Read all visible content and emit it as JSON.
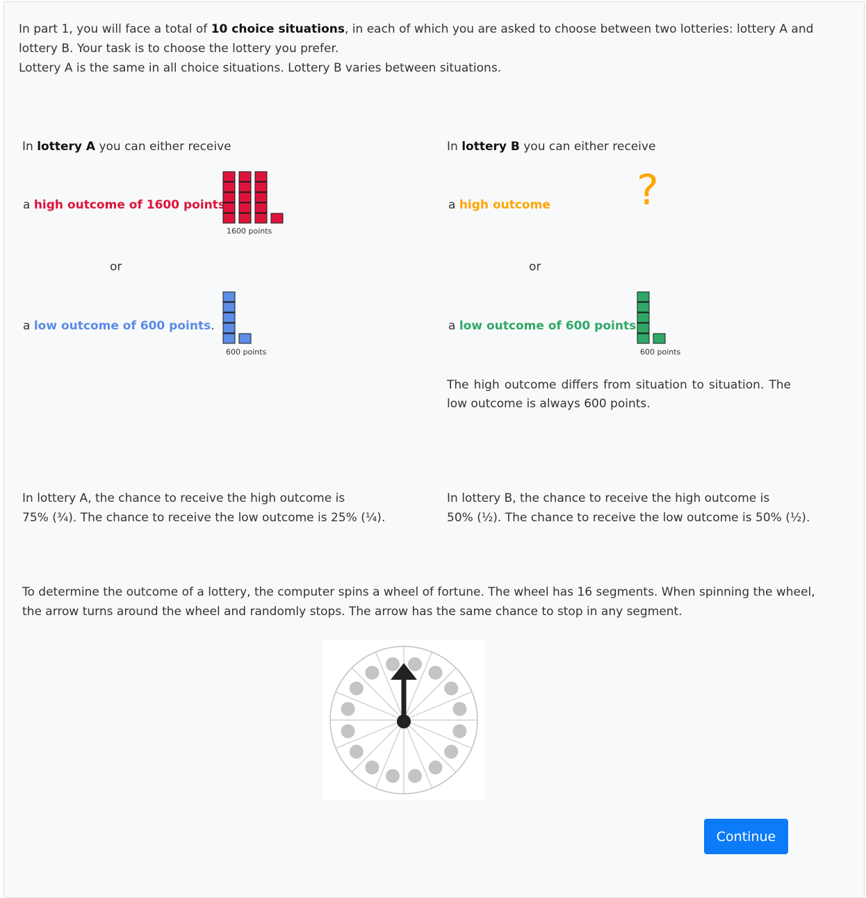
{
  "intro": {
    "line1_pre": "In part 1, you will face a total of ",
    "line1_bold": "10 choice situations",
    "line1_post": ", in each of which you are asked to choose between two lotteries: lottery A and",
    "line2": "lottery B. Your task is to choose the lottery you prefer.",
    "line3": "Lottery A is the same in all choice situations. Lottery B varies between situations."
  },
  "lottery_a": {
    "intro_pre": "In ",
    "intro_bold": "lottery A",
    "intro_post": " you can either receive",
    "high_pre": "a ",
    "high_label": "high outcome of 1600 points",
    "high_caption": "1600 points",
    "high_points": 1600,
    "or": "or",
    "low_pre": "a ",
    "low_label": "low outcome of 600 points",
    "low_post": ".",
    "low_caption": "600 points",
    "low_points": 600,
    "chance_line1": "In lottery A, the chance to receive the high outcome is",
    "chance_line2": "75% (¾). The chance to receive the low outcome is 25% (¼).",
    "high_color": "#dc143c",
    "low_color": "#5b8ce6"
  },
  "lottery_b": {
    "intro_pre": "In ",
    "intro_bold": "lottery B",
    "intro_post": " you can either receive",
    "high_pre": "a ",
    "high_label": "high outcome",
    "unknown_symbol": "?",
    "or": "or",
    "low_pre": "a ",
    "low_label": "low outcome of 600 points.",
    "low_caption": "600 points",
    "low_points": 600,
    "note": "The high outcome differs from situation to situation. The low outcome is always 600 points.",
    "chance_line1": "In lottery B, the chance to receive the high outcome is",
    "chance_line2": "50% (½). The chance to receive the low outcome is 50% (½).",
    "high_color": "#ffa500",
    "low_color": "#2fa866"
  },
  "wheel": {
    "line1": "To determine the outcome of a lottery, the computer spins a wheel of fortune. The wheel has 16 segments. When spinning the wheel,",
    "line2": "the arrow turns around the wheel and randomly stops. The arrow has the same chance to stop in any segment.",
    "segments": 16
  },
  "continue_label": "Continue"
}
